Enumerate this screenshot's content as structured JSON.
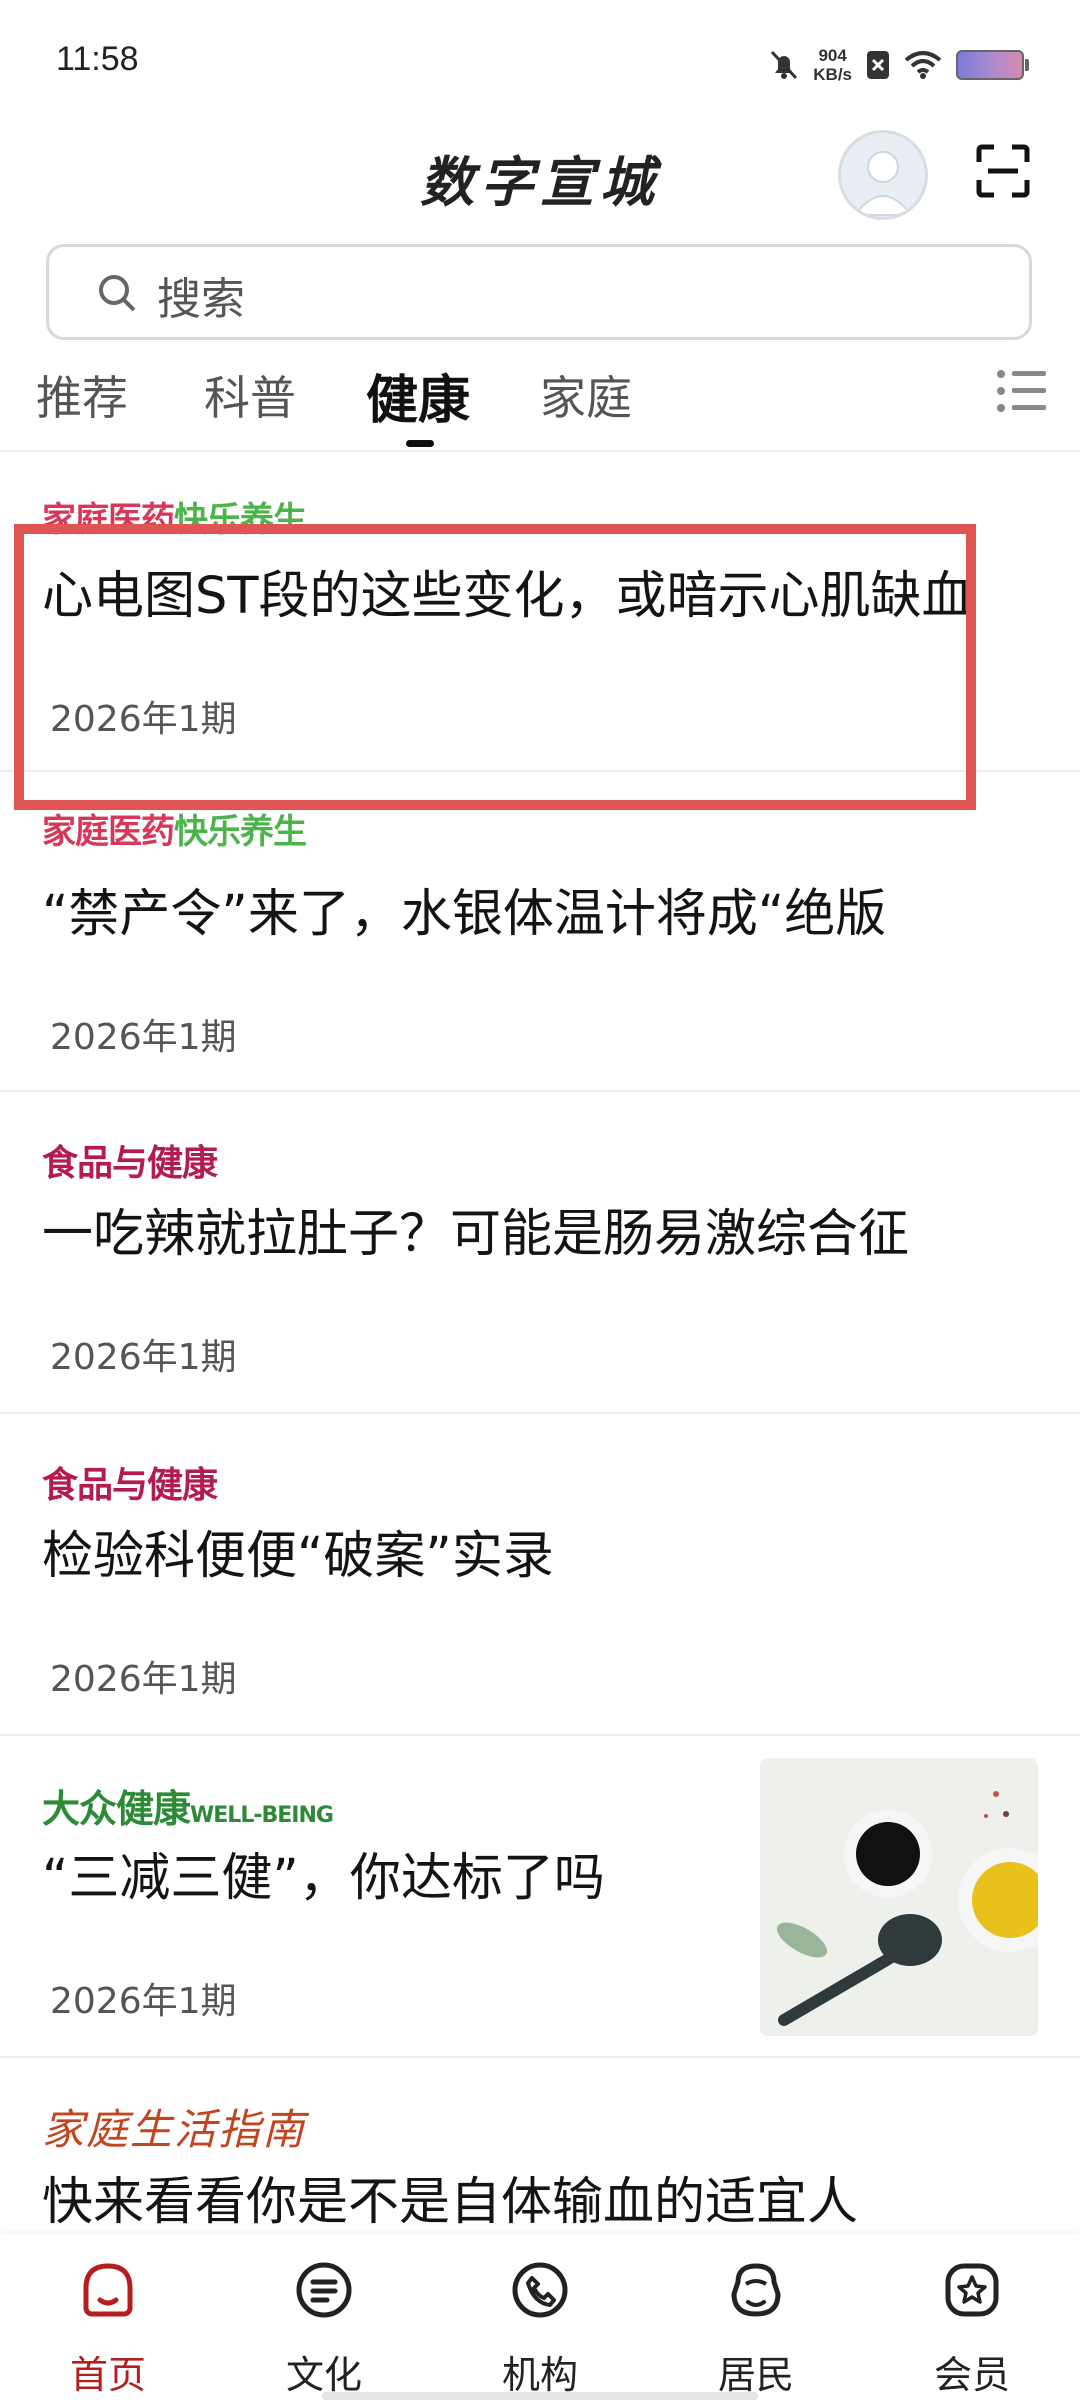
{
  "status_bar": {
    "time": "11:58",
    "net_speed_value": "904",
    "net_speed_unit": "KB/s"
  },
  "header": {
    "title": "数字宣城"
  },
  "search": {
    "placeholder": "搜索"
  },
  "tabs": [
    {
      "label": "推荐",
      "active": false
    },
    {
      "label": "科普",
      "active": false
    },
    {
      "label": "健康",
      "active": true
    },
    {
      "label": "家庭",
      "active": false
    }
  ],
  "articles": [
    {
      "badge_a": "家庭医药",
      "badge_b": "快乐养生",
      "title": "心电图ST段的这些变化，或暗示心肌缺血",
      "issue": "2026年1期"
    },
    {
      "badge_a": "家庭医药",
      "badge_b": "快乐养生",
      "title": "“禁产令”来了，水银体温计将成“绝版",
      "issue": "2026年1期"
    },
    {
      "badge": "食品与健康",
      "title": "一吃辣就拉肚子？可能是肠易激综合征",
      "issue": "2026年1期"
    },
    {
      "badge": "食品与健康",
      "title": "检验科便便“破案”实录",
      "issue": "2026年1期"
    },
    {
      "badge_a": "大众健康",
      "badge_b": "WELL-BEING",
      "title": "“三减三健”，你达标了吗",
      "issue": "2026年1期"
    },
    {
      "badge": "家庭生活指南",
      "title": "快来看看你是不是自体输血的适宜人"
    }
  ],
  "bottom_nav": [
    {
      "label": "首页",
      "icon": "home-icon",
      "active": true
    },
    {
      "label": "文化",
      "icon": "list-icon",
      "active": false
    },
    {
      "label": "机构",
      "icon": "phone-icon",
      "active": false
    },
    {
      "label": "居民",
      "icon": "residents-icon",
      "active": false
    },
    {
      "label": "会员",
      "icon": "member-star-icon",
      "active": false
    }
  ],
  "colors": {
    "accent": "#b51e1e",
    "highlight": "#e05552"
  }
}
